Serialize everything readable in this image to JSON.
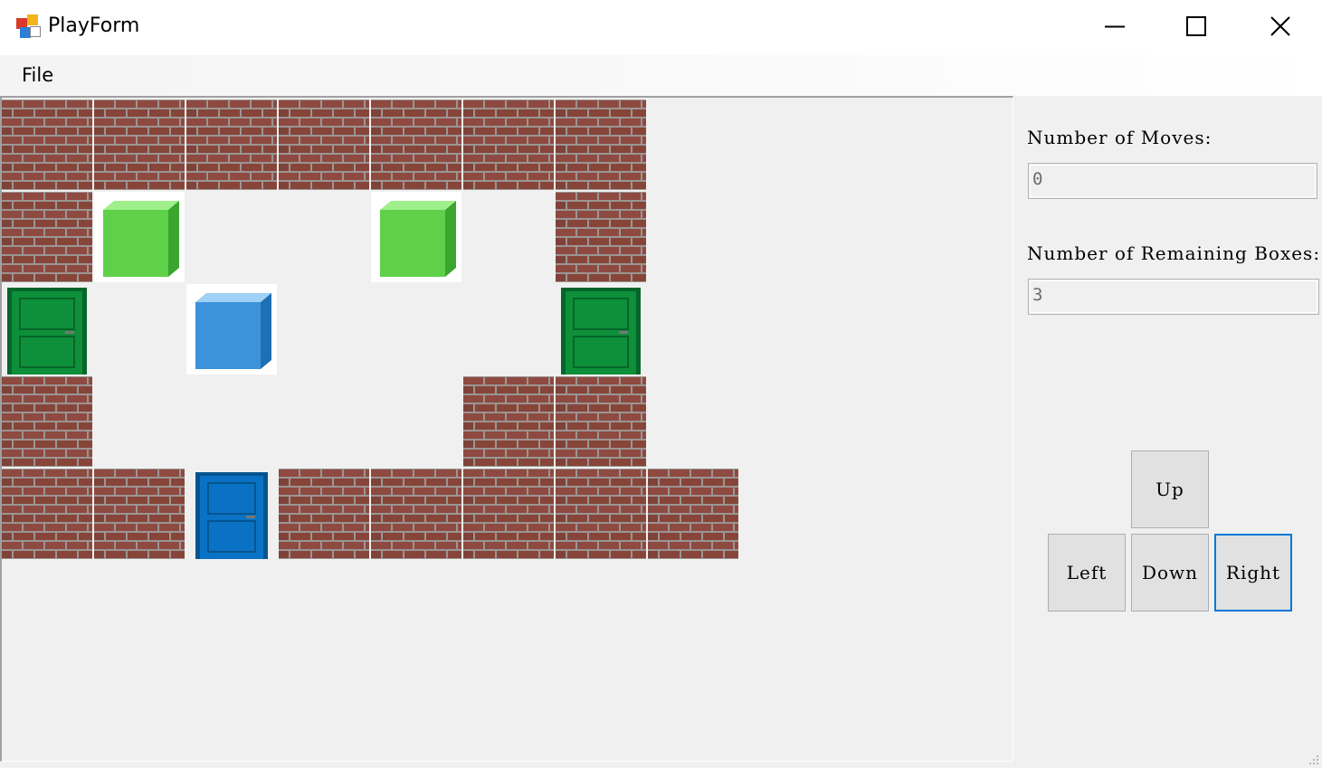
{
  "window": {
    "title": "PlayForm"
  },
  "menu": {
    "items": [
      "File"
    ]
  },
  "board": {
    "columns": 8,
    "rows": [
      [
        "wall",
        "wall",
        "wall",
        "wall",
        "wall",
        "wall",
        "wall",
        ""
      ],
      [
        "wall",
        "green-box",
        "",
        "",
        "green-box",
        "",
        "wall",
        ""
      ],
      [
        "green-door",
        "",
        "blue-box",
        "",
        "",
        "",
        "green-door",
        ""
      ],
      [
        "wall",
        "",
        "",
        "",
        "",
        "wall",
        "wall",
        ""
      ],
      [
        "wall",
        "wall",
        "blue-door",
        "wall",
        "wall",
        "wall",
        "wall",
        "wall"
      ]
    ]
  },
  "stats": {
    "moves_label": "Number of Moves:",
    "moves_value": "0",
    "boxes_label": "Number of Remaining Boxes:",
    "boxes_value": "3"
  },
  "controls": {
    "up": "Up",
    "left": "Left",
    "down": "Down",
    "right": "Right"
  },
  "colors": {
    "brick": "#8e4a40",
    "mortar": "#9b9593",
    "green_box": "#5ed04a",
    "blue_box": "#3d92dc",
    "green_door": "#0e8f3a",
    "blue_door": "#0a72c4",
    "focus": "#0078d7"
  }
}
